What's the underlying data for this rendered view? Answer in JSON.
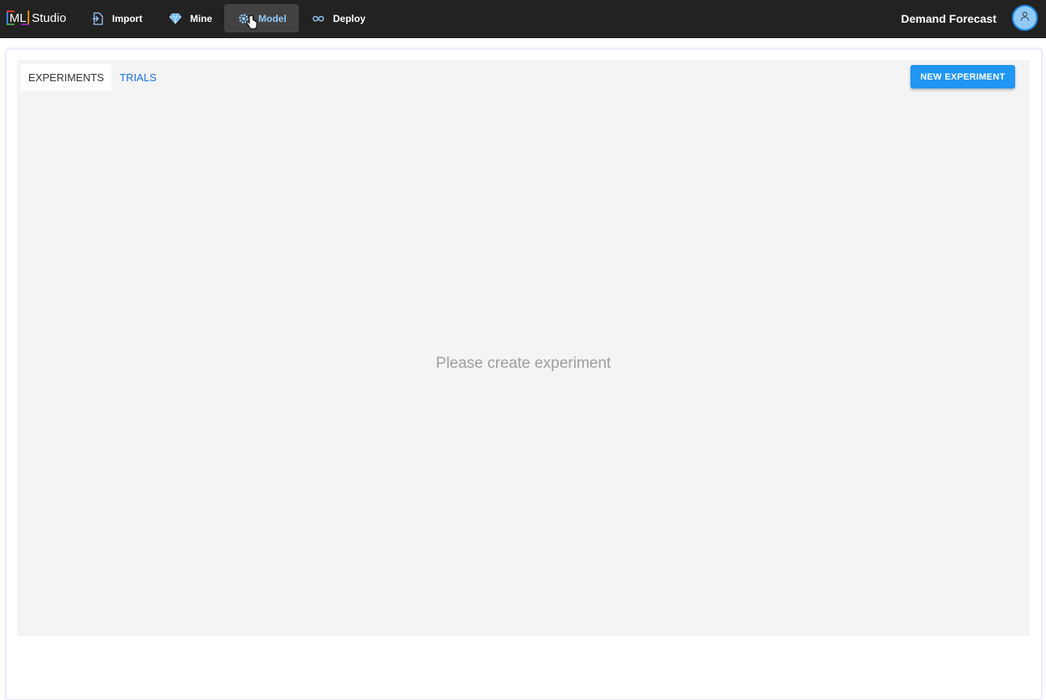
{
  "app": {
    "logo_ml": "ML",
    "logo_studio": "Studio"
  },
  "nav": {
    "items": [
      {
        "label": "Import",
        "icon": "import-file-icon"
      },
      {
        "label": "Mine",
        "icon": "diamond-icon"
      },
      {
        "label": "Model",
        "icon": "gear-icon",
        "active": true
      },
      {
        "label": "Deploy",
        "icon": "infinity-icon"
      }
    ]
  },
  "header": {
    "project_name": "Demand Forecast",
    "avatar_icon": "user-icon"
  },
  "tabs": [
    {
      "label": "EXPERIMENTS",
      "active": true
    },
    {
      "label": "TRIALS",
      "active": false
    }
  ],
  "actions": {
    "new_experiment": "NEW EXPERIMENT"
  },
  "empty_state": {
    "message": "Please create experiment"
  },
  "colors": {
    "topbar": "#222222",
    "accent": "#2196f3",
    "link": "#1a73e8",
    "active_nav_text": "#90caf9",
    "panel_bg": "#f4f4f4"
  }
}
